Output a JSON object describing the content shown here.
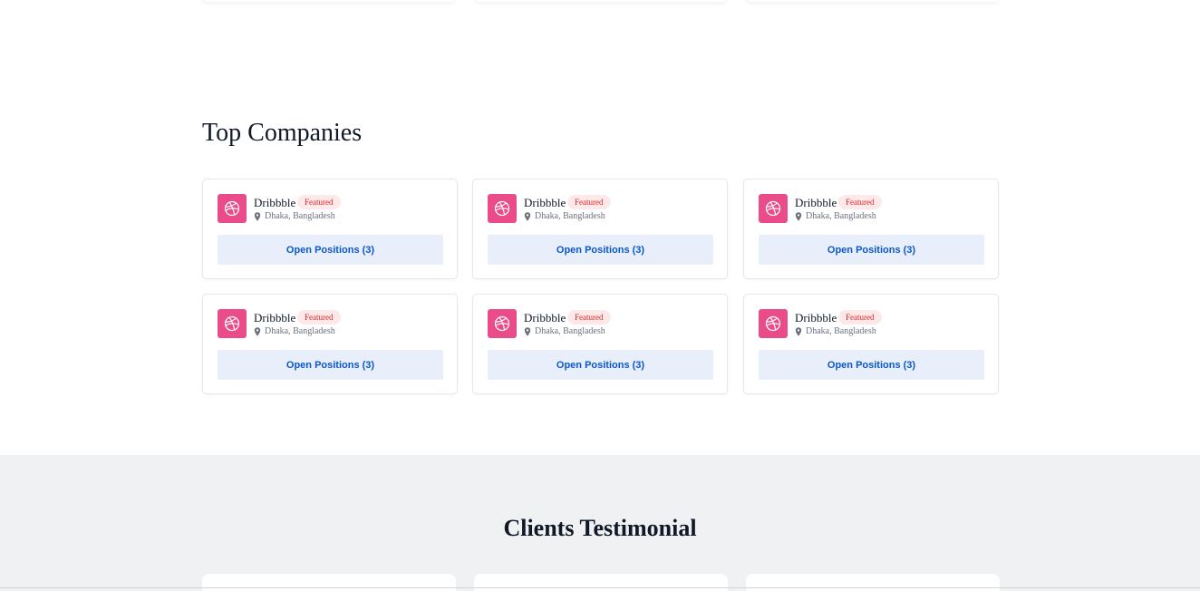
{
  "top_companies": {
    "title": "Top Companies",
    "cards": [
      {
        "name": "Dribbble",
        "badge": "Featured",
        "location": "Dhaka, Bangladesh",
        "button": "Open Positions (3)",
        "logo_icon": "dribbble-icon"
      },
      {
        "name": "Dribbble",
        "badge": "Featured",
        "location": "Dhaka, Bangladesh",
        "button": "Open Positions (3)",
        "logo_icon": "dribbble-icon"
      },
      {
        "name": "Dribbble",
        "badge": "Featured",
        "location": "Dhaka, Bangladesh",
        "button": "Open Positions (3)",
        "logo_icon": "dribbble-icon"
      },
      {
        "name": "Dribbble",
        "badge": "Featured",
        "location": "Dhaka, Bangladesh",
        "button": "Open Positions (3)",
        "logo_icon": "dribbble-icon"
      },
      {
        "name": "Dribbble",
        "badge": "Featured",
        "location": "Dhaka, Bangladesh",
        "button": "Open Positions (3)",
        "logo_icon": "dribbble-icon"
      },
      {
        "name": "Dribbble",
        "badge": "Featured",
        "location": "Dhaka, Bangladesh",
        "button": "Open Positions (3)",
        "logo_icon": "dribbble-icon"
      }
    ]
  },
  "testimonials": {
    "title": "Clients Testimonial"
  },
  "colors": {
    "brand_logo": "#ea4c89",
    "badge_bg": "#fde8ea",
    "badge_text": "#dc2626",
    "button_bg": "#e8effa",
    "button_text": "#0a58ca",
    "testimonial_bg": "#f0f1f3"
  }
}
